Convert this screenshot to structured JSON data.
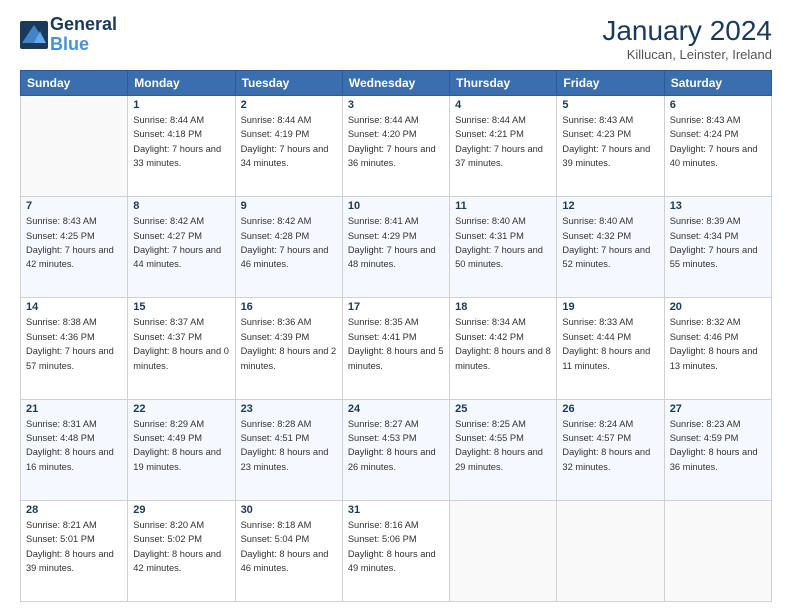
{
  "logo": {
    "line1": "General",
    "line2": "Blue"
  },
  "header": {
    "month": "January 2024",
    "location": "Killucan, Leinster, Ireland"
  },
  "days_of_week": [
    "Sunday",
    "Monday",
    "Tuesday",
    "Wednesday",
    "Thursday",
    "Friday",
    "Saturday"
  ],
  "weeks": [
    [
      {
        "day": "",
        "sunrise": "",
        "sunset": "",
        "daylight": ""
      },
      {
        "day": "1",
        "sunrise": "Sunrise: 8:44 AM",
        "sunset": "Sunset: 4:18 PM",
        "daylight": "Daylight: 7 hours and 33 minutes."
      },
      {
        "day": "2",
        "sunrise": "Sunrise: 8:44 AM",
        "sunset": "Sunset: 4:19 PM",
        "daylight": "Daylight: 7 hours and 34 minutes."
      },
      {
        "day": "3",
        "sunrise": "Sunrise: 8:44 AM",
        "sunset": "Sunset: 4:20 PM",
        "daylight": "Daylight: 7 hours and 36 minutes."
      },
      {
        "day": "4",
        "sunrise": "Sunrise: 8:44 AM",
        "sunset": "Sunset: 4:21 PM",
        "daylight": "Daylight: 7 hours and 37 minutes."
      },
      {
        "day": "5",
        "sunrise": "Sunrise: 8:43 AM",
        "sunset": "Sunset: 4:23 PM",
        "daylight": "Daylight: 7 hours and 39 minutes."
      },
      {
        "day": "6",
        "sunrise": "Sunrise: 8:43 AM",
        "sunset": "Sunset: 4:24 PM",
        "daylight": "Daylight: 7 hours and 40 minutes."
      }
    ],
    [
      {
        "day": "7",
        "sunrise": "Sunrise: 8:43 AM",
        "sunset": "Sunset: 4:25 PM",
        "daylight": "Daylight: 7 hours and 42 minutes."
      },
      {
        "day": "8",
        "sunrise": "Sunrise: 8:42 AM",
        "sunset": "Sunset: 4:27 PM",
        "daylight": "Daylight: 7 hours and 44 minutes."
      },
      {
        "day": "9",
        "sunrise": "Sunrise: 8:42 AM",
        "sunset": "Sunset: 4:28 PM",
        "daylight": "Daylight: 7 hours and 46 minutes."
      },
      {
        "day": "10",
        "sunrise": "Sunrise: 8:41 AM",
        "sunset": "Sunset: 4:29 PM",
        "daylight": "Daylight: 7 hours and 48 minutes."
      },
      {
        "day": "11",
        "sunrise": "Sunrise: 8:40 AM",
        "sunset": "Sunset: 4:31 PM",
        "daylight": "Daylight: 7 hours and 50 minutes."
      },
      {
        "day": "12",
        "sunrise": "Sunrise: 8:40 AM",
        "sunset": "Sunset: 4:32 PM",
        "daylight": "Daylight: 7 hours and 52 minutes."
      },
      {
        "day": "13",
        "sunrise": "Sunrise: 8:39 AM",
        "sunset": "Sunset: 4:34 PM",
        "daylight": "Daylight: 7 hours and 55 minutes."
      }
    ],
    [
      {
        "day": "14",
        "sunrise": "Sunrise: 8:38 AM",
        "sunset": "Sunset: 4:36 PM",
        "daylight": "Daylight: 7 hours and 57 minutes."
      },
      {
        "day": "15",
        "sunrise": "Sunrise: 8:37 AM",
        "sunset": "Sunset: 4:37 PM",
        "daylight": "Daylight: 8 hours and 0 minutes."
      },
      {
        "day": "16",
        "sunrise": "Sunrise: 8:36 AM",
        "sunset": "Sunset: 4:39 PM",
        "daylight": "Daylight: 8 hours and 2 minutes."
      },
      {
        "day": "17",
        "sunrise": "Sunrise: 8:35 AM",
        "sunset": "Sunset: 4:41 PM",
        "daylight": "Daylight: 8 hours and 5 minutes."
      },
      {
        "day": "18",
        "sunrise": "Sunrise: 8:34 AM",
        "sunset": "Sunset: 4:42 PM",
        "daylight": "Daylight: 8 hours and 8 minutes."
      },
      {
        "day": "19",
        "sunrise": "Sunrise: 8:33 AM",
        "sunset": "Sunset: 4:44 PM",
        "daylight": "Daylight: 8 hours and 11 minutes."
      },
      {
        "day": "20",
        "sunrise": "Sunrise: 8:32 AM",
        "sunset": "Sunset: 4:46 PM",
        "daylight": "Daylight: 8 hours and 13 minutes."
      }
    ],
    [
      {
        "day": "21",
        "sunrise": "Sunrise: 8:31 AM",
        "sunset": "Sunset: 4:48 PM",
        "daylight": "Daylight: 8 hours and 16 minutes."
      },
      {
        "day": "22",
        "sunrise": "Sunrise: 8:29 AM",
        "sunset": "Sunset: 4:49 PM",
        "daylight": "Daylight: 8 hours and 19 minutes."
      },
      {
        "day": "23",
        "sunrise": "Sunrise: 8:28 AM",
        "sunset": "Sunset: 4:51 PM",
        "daylight": "Daylight: 8 hours and 23 minutes."
      },
      {
        "day": "24",
        "sunrise": "Sunrise: 8:27 AM",
        "sunset": "Sunset: 4:53 PM",
        "daylight": "Daylight: 8 hours and 26 minutes."
      },
      {
        "day": "25",
        "sunrise": "Sunrise: 8:25 AM",
        "sunset": "Sunset: 4:55 PM",
        "daylight": "Daylight: 8 hours and 29 minutes."
      },
      {
        "day": "26",
        "sunrise": "Sunrise: 8:24 AM",
        "sunset": "Sunset: 4:57 PM",
        "daylight": "Daylight: 8 hours and 32 minutes."
      },
      {
        "day": "27",
        "sunrise": "Sunrise: 8:23 AM",
        "sunset": "Sunset: 4:59 PM",
        "daylight": "Daylight: 8 hours and 36 minutes."
      }
    ],
    [
      {
        "day": "28",
        "sunrise": "Sunrise: 8:21 AM",
        "sunset": "Sunset: 5:01 PM",
        "daylight": "Daylight: 8 hours and 39 minutes."
      },
      {
        "day": "29",
        "sunrise": "Sunrise: 8:20 AM",
        "sunset": "Sunset: 5:02 PM",
        "daylight": "Daylight: 8 hours and 42 minutes."
      },
      {
        "day": "30",
        "sunrise": "Sunrise: 8:18 AM",
        "sunset": "Sunset: 5:04 PM",
        "daylight": "Daylight: 8 hours and 46 minutes."
      },
      {
        "day": "31",
        "sunrise": "Sunrise: 8:16 AM",
        "sunset": "Sunset: 5:06 PM",
        "daylight": "Daylight: 8 hours and 49 minutes."
      },
      {
        "day": "",
        "sunrise": "",
        "sunset": "",
        "daylight": ""
      },
      {
        "day": "",
        "sunrise": "",
        "sunset": "",
        "daylight": ""
      },
      {
        "day": "",
        "sunrise": "",
        "sunset": "",
        "daylight": ""
      }
    ]
  ]
}
